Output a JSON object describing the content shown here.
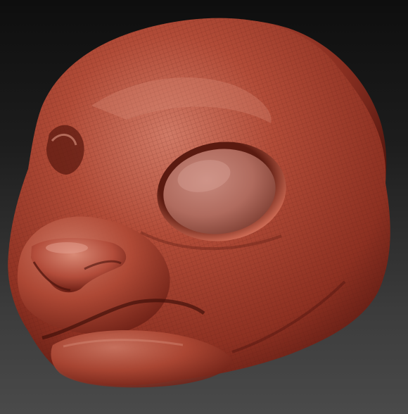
{
  "scene": {
    "subject_icon": "sculpted-animal-head-icon",
    "colors": {
      "background_top": "#0e0e0e",
      "background_bottom": "#4a4a4a",
      "clay_base": "#a8402e",
      "clay_highlight": "#d98a78",
      "clay_shadow": "#4a120c",
      "wire_mesh": "#5a1a12"
    }
  }
}
